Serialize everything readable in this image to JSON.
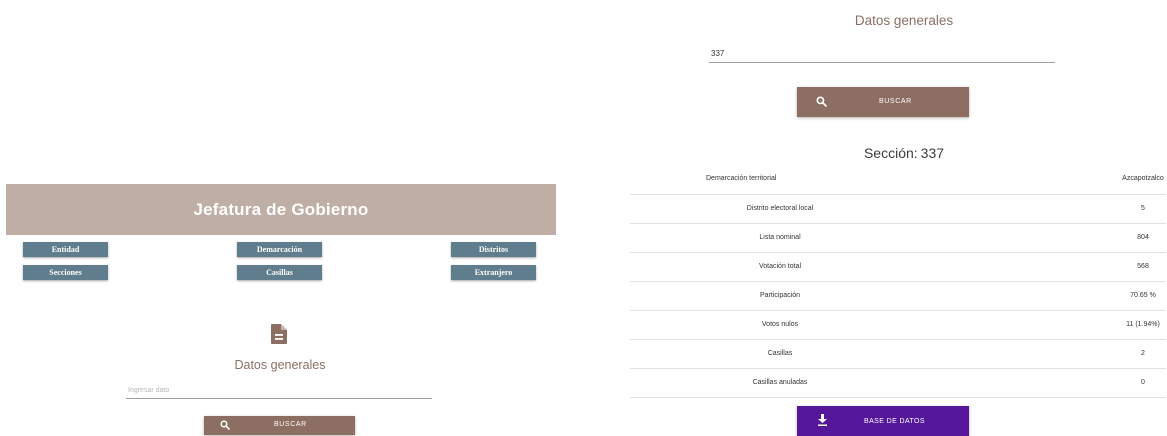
{
  "left_panel": {
    "banner_title": "Jefatura de Gobierno",
    "nav_buttons": [
      "Entidad",
      "Demarcación",
      "Distritos",
      "Secciones",
      "Casillas",
      "Extranjero"
    ],
    "section_title": "Datos generales",
    "input_placeholder": "Ingresar dato",
    "search_label": "BUSCAR"
  },
  "right_panel": {
    "section_title": "Datos generales",
    "input_value": "337",
    "search_label": "BUSCAR",
    "seccion_prefix": "Sección:",
    "seccion_value": "337",
    "rows": [
      {
        "label": "Demarcación territorial",
        "value": "Azcapotzalco"
      },
      {
        "label": "Distrito electoral local",
        "value": "5"
      },
      {
        "label": "Lista nominal",
        "value": "804"
      },
      {
        "label": "Votación total",
        "value": "568"
      },
      {
        "label": "Participación",
        "value": "70.65 %"
      },
      {
        "label": "Votos nulos",
        "value": "11 (1.94%)"
      },
      {
        "label": "Casillas",
        "value": "2"
      },
      {
        "label": "Casillas anuladas",
        "value": "0"
      }
    ],
    "download_label": "BASE DE DATOS"
  },
  "colors": {
    "banner": "#bfaea6",
    "nav_button": "#5f7d8c",
    "search_button": "#8c6e62",
    "download_button": "#55179a",
    "section_title": "#8a6f63"
  },
  "icons": {
    "document": "document-icon",
    "search": "search-icon",
    "download": "download-icon"
  }
}
